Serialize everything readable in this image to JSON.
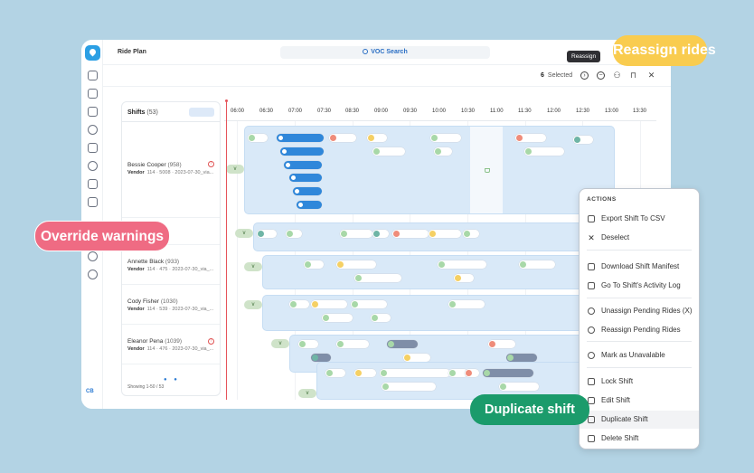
{
  "app": {
    "title": "Ride Plan",
    "search": "VOC Search",
    "rail_initials": "CB"
  },
  "toolbar": {
    "selected_count": "6",
    "selected_label": "Selected",
    "tooltip": "Reassign"
  },
  "shifts_panel": {
    "title": "Shifts",
    "count": "(53)",
    "footer": "Showing 1-50 / 53",
    "rows": [
      {
        "name": "Bessie Cooper",
        "id": "(958)",
        "vendor": "Vendor",
        "details": "114 · 5008 · 2023-07-30_via...",
        "warning": true
      },
      {
        "name": "Annette Black",
        "id": "(933)",
        "vendor": "Vendor",
        "details": "114 · 475 · 2023-07-30_via_...",
        "warning": false
      },
      {
        "name": "Cody Fisher",
        "id": "(1030)",
        "vendor": "Vendor",
        "details": "114 · 539 · 2023-07-30_via_...",
        "warning": false
      },
      {
        "name": "Eleanor Pena",
        "id": "(1039)",
        "vendor": "Vendor",
        "details": "114 · 476 · 2023-07-30_via_...",
        "warning": true
      }
    ]
  },
  "timeline": {
    "hours": [
      "06:00",
      "06:30",
      "07:00",
      "07:30",
      "08:30",
      "09:00",
      "09:30",
      "10:00",
      "10:30",
      "11:00",
      "11:30",
      "12:00",
      "12:30",
      "13:00",
      "13:30"
    ],
    "vehicle_label": "v"
  },
  "actions_menu": {
    "header": "ACTIONS",
    "groups": [
      [
        {
          "label": "Export Shift To CSV",
          "icon": "download-icon"
        },
        {
          "label": "Deselect",
          "icon": "close-icon"
        }
      ],
      [
        {
          "label": "Download Shift Manifest",
          "icon": "file-download-icon"
        },
        {
          "label": "Go To Shift's Activity Log",
          "icon": "external-link-icon"
        }
      ],
      [
        {
          "label": "Unassign Pending Rides  (X)",
          "icon": "minus-circle-icon"
        },
        {
          "label": "Reassign Pending Rides",
          "icon": "reassign-icon"
        }
      ],
      [
        {
          "label": "Mark as Unavalable",
          "icon": "block-icon"
        }
      ],
      [
        {
          "label": "Lock Shift",
          "icon": "lock-icon"
        },
        {
          "label": "Edit Shift",
          "icon": "pencil-icon"
        },
        {
          "label": "Duplicate Shift",
          "icon": "copy-icon"
        },
        {
          "label": "Delete Shift",
          "icon": "trash-icon"
        }
      ]
    ]
  },
  "callouts": {
    "reassign": "Reassign rides",
    "override": "Override warnings",
    "duplicate": "Duplicate shift"
  },
  "colors": {
    "accent": "#2f87da",
    "callout_yellow": "#f9cc4f",
    "callout_pink": "#ef6b83",
    "callout_green": "#1b9b6b"
  }
}
